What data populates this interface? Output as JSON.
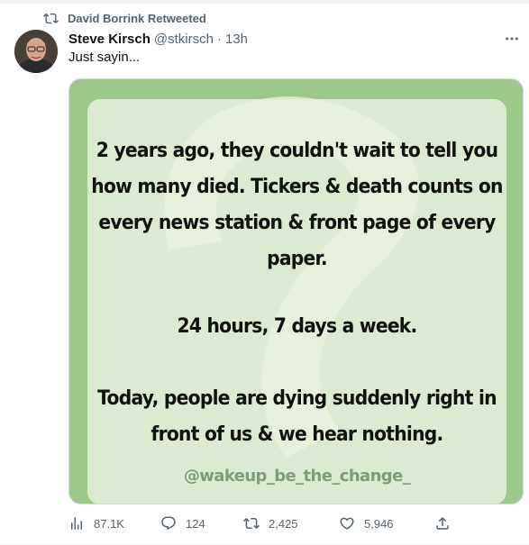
{
  "retweet": {
    "label": "David Borrink Retweeted",
    "icon": "retweet-icon"
  },
  "author": {
    "name": "Steve Kirsch",
    "handle": "@stkirsch",
    "time": "13h"
  },
  "tweet_text": "Just sayin...",
  "media": {
    "lines_paragraph1": [
      "2 years ago, they couldn't wait to tell you",
      "how many died. Tickers & death counts on",
      "every news station & front page of every",
      "paper."
    ],
    "paragraph2": "24 hours, 7 days a week.",
    "lines_paragraph3": [
      "Today, people are dying suddenly right in",
      "front of us & we hear nothing."
    ],
    "credit": "@wakeup_be_the_change_",
    "colors": {
      "outer": "#9cc88a",
      "inner": "#dcead2",
      "credit": "#7b9e74"
    }
  },
  "actions": {
    "views": "87.1K",
    "replies": "124",
    "retweets": "2,425",
    "likes": "5,946"
  }
}
